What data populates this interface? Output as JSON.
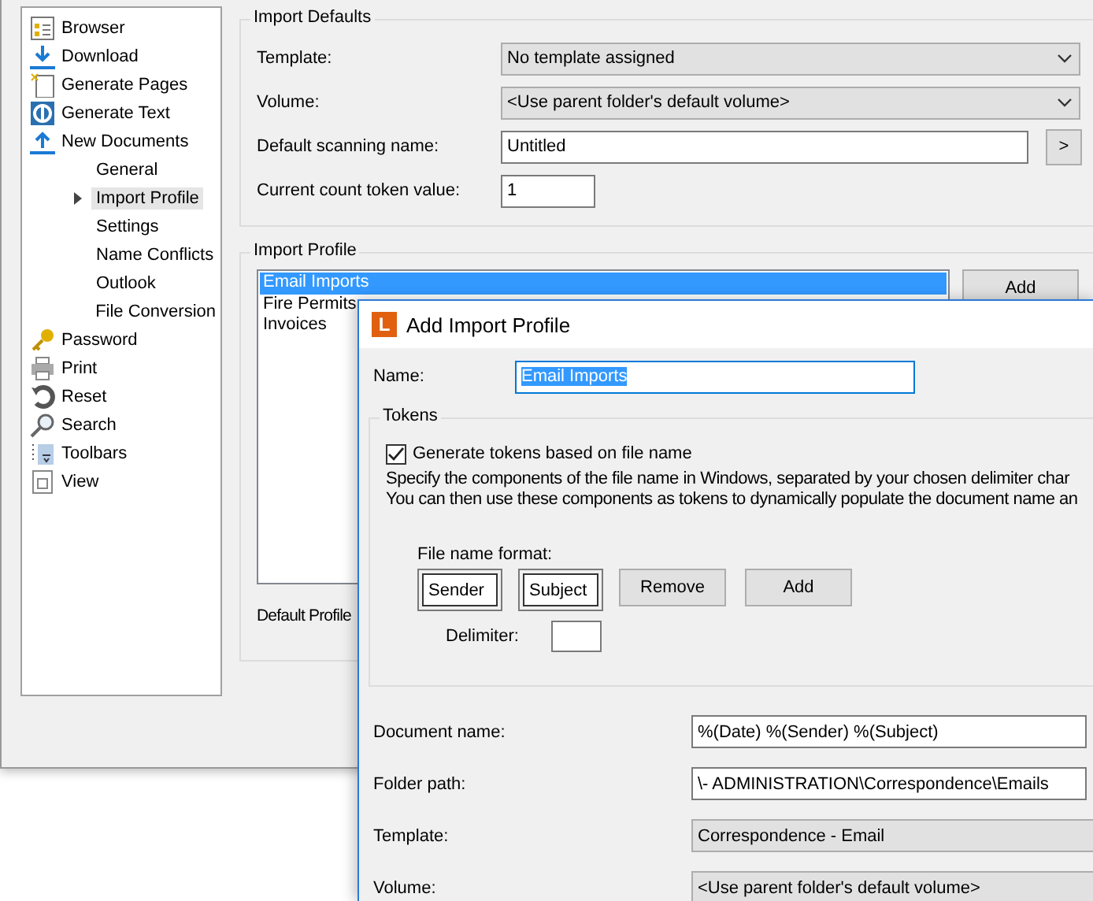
{
  "sidebar": {
    "items": [
      {
        "label": "Browser",
        "selected": false
      },
      {
        "label": "Download",
        "selected": false
      },
      {
        "label": "Generate Pages",
        "selected": false
      },
      {
        "label": "Generate Text",
        "selected": false
      },
      {
        "label": "New Documents",
        "selected": false,
        "children": [
          {
            "label": "General",
            "selected": false
          },
          {
            "label": "Import Profile",
            "selected": true
          },
          {
            "label": "Settings",
            "selected": false
          },
          {
            "label": "Name Conflicts",
            "selected": false
          },
          {
            "label": "Outlook",
            "selected": false
          },
          {
            "label": "File Conversion",
            "selected": false
          }
        ]
      },
      {
        "label": "Password",
        "selected": false
      },
      {
        "label": "Print",
        "selected": false
      },
      {
        "label": "Reset",
        "selected": false
      },
      {
        "label": "Search",
        "selected": false
      },
      {
        "label": "Toolbars",
        "selected": false
      },
      {
        "label": "View",
        "selected": false
      }
    ]
  },
  "import_defaults": {
    "title": "Import Defaults",
    "template": {
      "label": "Template:",
      "value": "No template assigned"
    },
    "volume": {
      "label": "Volume:",
      "value": "<Use parent folder's default volume>"
    },
    "scanning_name": {
      "label": "Default scanning name:",
      "value": "Untitled",
      "button": ">"
    },
    "count_token": {
      "label": "Current count token value:",
      "value": "1"
    }
  },
  "import_profile": {
    "title": "Import Profile",
    "profiles": [
      {
        "label": "Email Imports",
        "selected": true
      },
      {
        "label": "Fire Permits",
        "selected": false
      },
      {
        "label": "Invoices",
        "selected": false
      }
    ],
    "add_button": "Add",
    "default_profile_label": "Default Profile"
  },
  "dialog": {
    "title": "Add Import Profile",
    "logo": "L",
    "name": {
      "label": "Name:",
      "value": "Email Imports"
    },
    "tokens": {
      "title": "Tokens",
      "generate": {
        "label": "Generate tokens based on file name",
        "checked": true
      },
      "description": [
        "Specify the components of the file name in Windows, separated by your chosen delimiter char",
        "You can then use these components as tokens to dynamically populate the document name an"
      ],
      "format_label": "File name format:",
      "format_parts": [
        "Sender",
        "Subject"
      ],
      "remove_button": "Remove",
      "add_button": "Add",
      "delimiter": {
        "label": "Delimiter:"
      }
    },
    "document_name": {
      "label": "Document name:",
      "value": "%(Date) %(Sender) %(Subject)"
    },
    "folder_path": {
      "label": "Folder path:",
      "value": "\\- ADMINISTRATION\\Correspondence\\Emails"
    },
    "template": {
      "label": "Template:",
      "value": "Correspondence - Email"
    },
    "volume": {
      "label": "Volume:",
      "value": "<Use parent folder's default volume>"
    }
  }
}
